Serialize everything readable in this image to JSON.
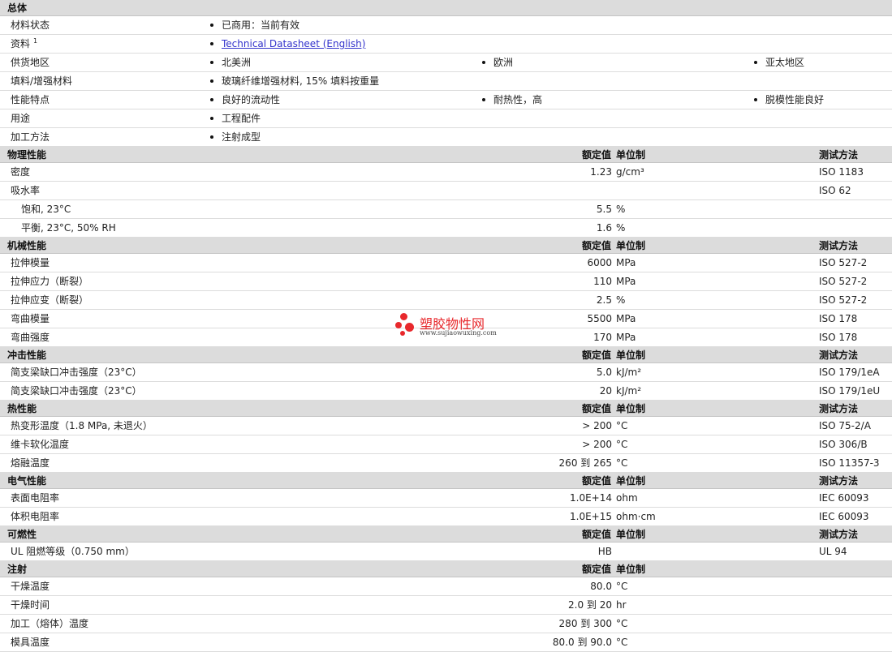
{
  "general": {
    "title": "总体",
    "rows": [
      {
        "name": "材料状态",
        "items": [
          "已商用：当前有效"
        ]
      },
      {
        "name": "资料",
        "sup": "1",
        "items": [
          "Technical Datasheet (English)"
        ],
        "link": true
      },
      {
        "name": "供货地区",
        "items": [
          "北美洲",
          "欧洲",
          "亚太地区"
        ]
      },
      {
        "name": "填料/增强材料",
        "items": [
          "玻璃纤维增强材料, 15% 填料按重量"
        ]
      },
      {
        "name": "性能特点",
        "items": [
          "良好的流动性",
          "耐热性，高",
          "脱模性能良好"
        ]
      },
      {
        "name": "用途",
        "items": [
          "工程配件"
        ]
      },
      {
        "name": "加工方法",
        "items": [
          "注射成型"
        ]
      }
    ]
  },
  "col_headers": {
    "value": "额定值",
    "unit": "单位制",
    "method": "测试方法"
  },
  "sections": [
    {
      "title": "物理性能",
      "show_method": true,
      "rows": [
        {
          "name": "密度",
          "value": "1.23",
          "unit": "g/cm³",
          "method": "ISO 1183"
        },
        {
          "name": "吸水率",
          "value": "",
          "unit": "",
          "method": "ISO 62"
        },
        {
          "name": "饱和, 23°C",
          "value": "5.5",
          "unit": "%",
          "method": "",
          "sub": true
        },
        {
          "name": "平衡, 23°C, 50% RH",
          "value": "1.6",
          "unit": "%",
          "method": "",
          "sub": true
        }
      ]
    },
    {
      "title": "机械性能",
      "show_method": true,
      "rows": [
        {
          "name": "拉伸模量",
          "value": "6000",
          "unit": "MPa",
          "method": "ISO 527-2"
        },
        {
          "name": "拉伸应力（断裂）",
          "value": "110",
          "unit": "MPa",
          "method": "ISO 527-2"
        },
        {
          "name": "拉伸应变（断裂）",
          "value": "2.5",
          "unit": "%",
          "method": "ISO 527-2"
        },
        {
          "name": "弯曲模量",
          "value": "5500",
          "unit": "MPa",
          "method": "ISO 178"
        },
        {
          "name": "弯曲强度",
          "value": "170",
          "unit": "MPa",
          "method": "ISO 178"
        }
      ]
    },
    {
      "title": "冲击性能",
      "show_method": true,
      "rows": [
        {
          "name": "简支梁缺口冲击强度（23°C）",
          "value": "5.0",
          "unit": "kJ/m²",
          "method": "ISO 179/1eA"
        },
        {
          "name": "简支梁缺口冲击强度（23°C）",
          "value": "20",
          "unit": "kJ/m²",
          "method": "ISO 179/1eU"
        }
      ]
    },
    {
      "title": "热性能",
      "show_method": true,
      "rows": [
        {
          "name": "热变形温度（1.8 MPa, 未退火）",
          "value": "> 200",
          "unit": "°C",
          "method": "ISO 75-2/A"
        },
        {
          "name": "维卡软化温度",
          "value": "> 200",
          "unit": "°C",
          "method": "ISO 306/B"
        },
        {
          "name": "熔融温度",
          "value": "260 到  265",
          "unit": "°C",
          "method": "ISO 11357-3"
        }
      ]
    },
    {
      "title": "电气性能",
      "show_method": true,
      "rows": [
        {
          "name": "表面电阻率",
          "value": "1.0E+14",
          "unit": "ohm",
          "method": "IEC 60093"
        },
        {
          "name": "体积电阻率",
          "value": "1.0E+15",
          "unit": "ohm·cm",
          "method": "IEC 60093"
        }
      ]
    },
    {
      "title": "可燃性",
      "show_method": true,
      "rows": [
        {
          "name": "UL 阻燃等级（0.750 mm）",
          "value": "HB",
          "unit": "",
          "method": "UL 94"
        }
      ]
    },
    {
      "title": "注射",
      "show_method": false,
      "rows": [
        {
          "name": "干燥温度",
          "value": "80.0",
          "unit": "°C",
          "method": ""
        },
        {
          "name": "干燥时间",
          "value": "2.0 到  20",
          "unit": "hr",
          "method": ""
        },
        {
          "name": "加工（熔体）温度",
          "value": "280 到  300",
          "unit": "°C",
          "method": ""
        },
        {
          "name": "模具温度",
          "value": "80.0 到  90.0",
          "unit": "°C",
          "method": ""
        }
      ]
    }
  ],
  "watermark": {
    "brand": "塑胶物性网",
    "url": "www.sujiaowuxing.com",
    "color": "#e8282c"
  }
}
